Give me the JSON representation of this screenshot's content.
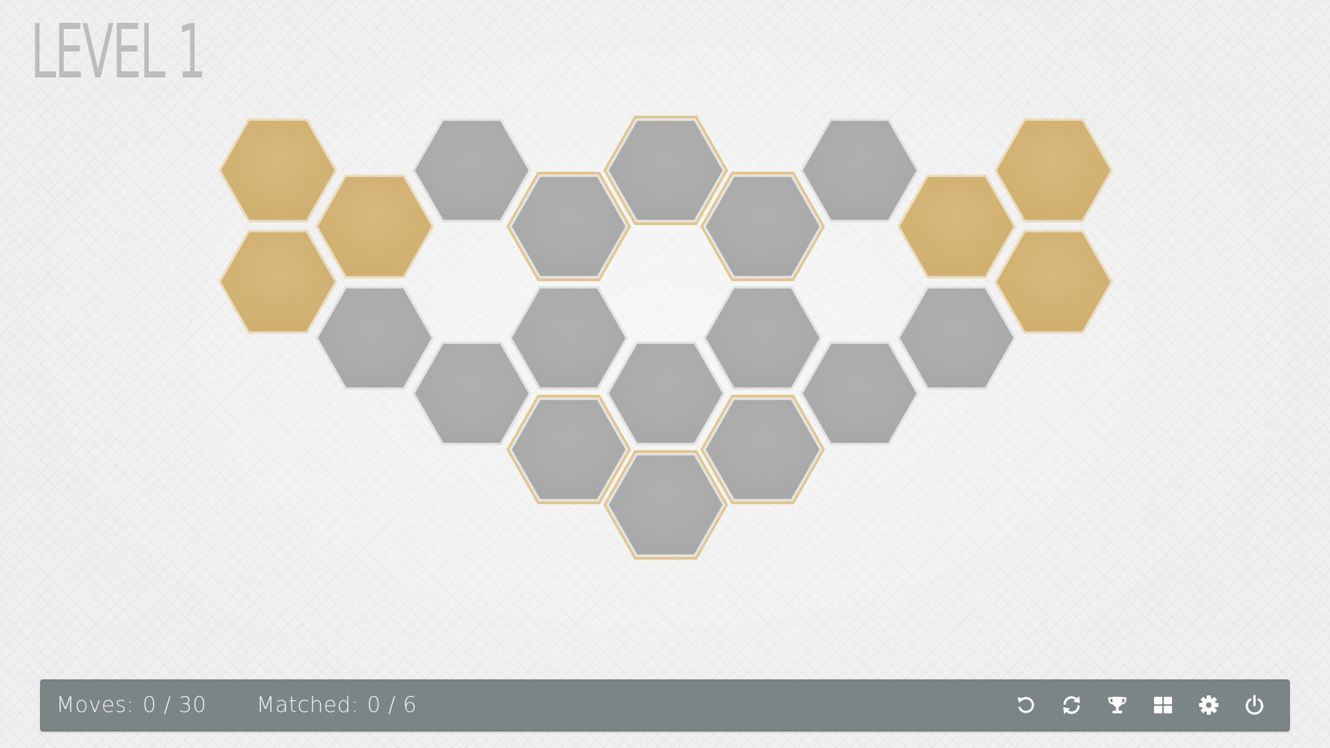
{
  "header": {
    "level_title": "LEVEL 1"
  },
  "colors": {
    "tile_gray": "#a7a7a7",
    "tile_gold": "#cfae6c",
    "highlight_border": "#e2c68d",
    "bar_background": "#7b8586",
    "bar_text": "#f2f2f2"
  },
  "board": {
    "tiles": [
      {
        "col": 0,
        "row": 0,
        "state": "gold"
      },
      {
        "col": 0,
        "row": 1,
        "state": "gold"
      },
      {
        "col": 1,
        "row": 0,
        "state": "gold"
      },
      {
        "col": 1,
        "row": 1,
        "state": "gray"
      },
      {
        "col": 2,
        "row": 0,
        "state": "gray"
      },
      {
        "col": 2,
        "row": 2,
        "state": "gray"
      },
      {
        "col": 3,
        "row": 0,
        "state": "gray",
        "highlighted": true
      },
      {
        "col": 3,
        "row": 1,
        "state": "gray"
      },
      {
        "col": 3,
        "row": 2,
        "state": "gray",
        "highlighted": true
      },
      {
        "col": 4,
        "row": 0,
        "state": "gray",
        "highlighted": true
      },
      {
        "col": 4,
        "row": 2,
        "state": "gray"
      },
      {
        "col": 4,
        "row": 3,
        "state": "gray",
        "highlighted": true
      },
      {
        "col": 5,
        "row": 0,
        "state": "gray",
        "highlighted": true
      },
      {
        "col": 5,
        "row": 1,
        "state": "gray"
      },
      {
        "col": 5,
        "row": 2,
        "state": "gray",
        "highlighted": true
      },
      {
        "col": 6,
        "row": 0,
        "state": "gray"
      },
      {
        "col": 6,
        "row": 2,
        "state": "gray"
      },
      {
        "col": 7,
        "row": 0,
        "state": "gold"
      },
      {
        "col": 7,
        "row": 1,
        "state": "gray"
      },
      {
        "col": 8,
        "row": 0,
        "state": "gold"
      },
      {
        "col": 8,
        "row": 1,
        "state": "gold"
      }
    ]
  },
  "status_bar": {
    "moves_label": "Moves:",
    "moves_value": "0 / 30",
    "matched_label": "Matched:",
    "matched_value": "0 / 6"
  },
  "toolbar": {
    "buttons": [
      {
        "icon": "undo-icon"
      },
      {
        "icon": "restart-icon"
      },
      {
        "icon": "trophy-icon"
      },
      {
        "icon": "level-grid-icon"
      },
      {
        "icon": "settings-gear-icon"
      },
      {
        "icon": "power-icon"
      }
    ]
  }
}
